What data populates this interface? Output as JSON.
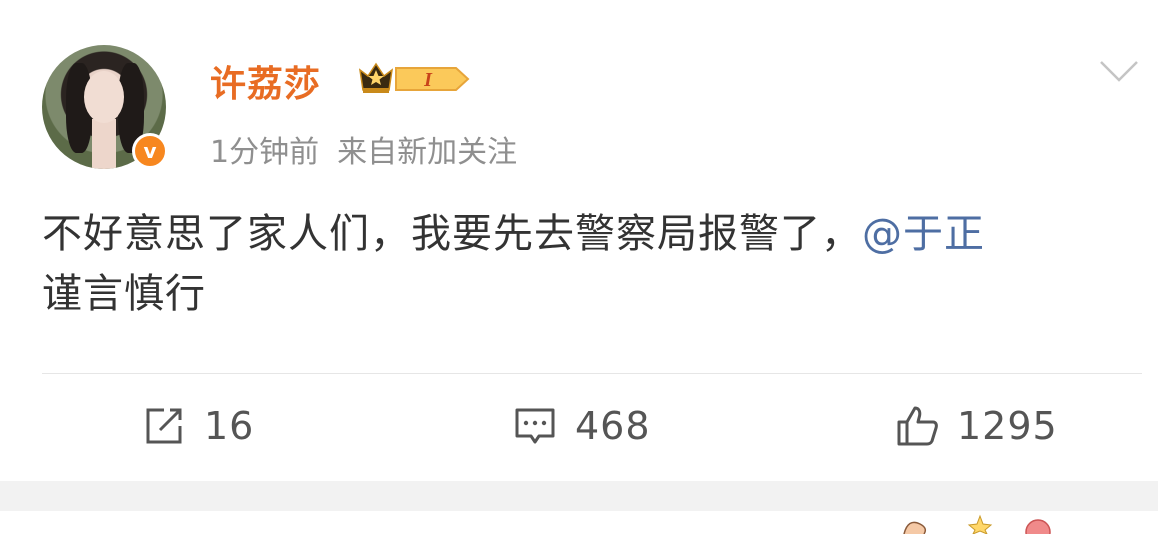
{
  "post": {
    "author": "许荔莎",
    "rank_badge": "I",
    "time": "1分钟前",
    "source": "来自新加关注",
    "text_main": "不好意思了家人们，我要先去警察局报警了，",
    "mention": "@于正",
    "text_tail": "谨言慎行"
  },
  "actions": {
    "repost_count": "16",
    "comment_count": "468",
    "like_count": "1295"
  },
  "colors": {
    "author": "#e86c23",
    "mention": "#4e6ea3",
    "verified": "#f7871f"
  },
  "icons": [
    "avatar",
    "verified-badge-icon",
    "crown-rank-icon",
    "chevron-down-icon",
    "repost-icon",
    "comment-icon",
    "like-icon"
  ]
}
